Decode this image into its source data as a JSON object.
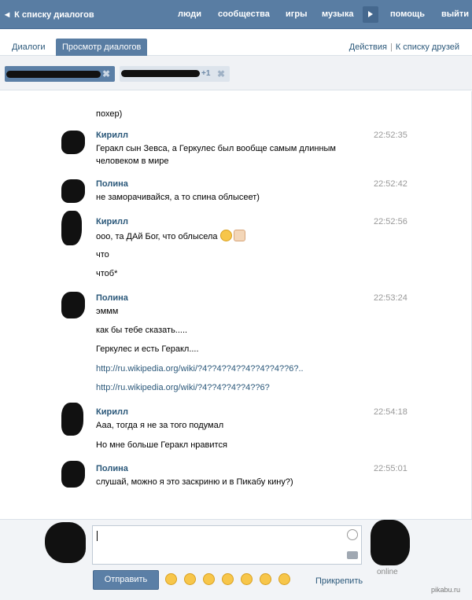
{
  "nav": {
    "back_label": "К списку диалогов",
    "links": [
      "люди",
      "сообщества",
      "игры",
      "музыка",
      "помощь",
      "выйти"
    ],
    "accent": "#597da3"
  },
  "tabs": {
    "items": [
      "Диалоги",
      "Просмотр диалогов"
    ],
    "active": "Просмотр диалогов",
    "actions_label": "Действия",
    "friends_label": "К списку друзей",
    "separator": "|"
  },
  "chips": {
    "plus_count": "+1",
    "close_glyph": "✖"
  },
  "messages": [
    {
      "author": "",
      "time": "",
      "lines": [
        "похер)"
      ]
    },
    {
      "author": "Кирилл",
      "time": "22:52:35",
      "lines": [
        "Геракл сын Зевса, а Геркулес был вообще самым длинным",
        "человеком в мире"
      ]
    },
    {
      "author": "Полина",
      "time": "22:52:42",
      "lines": [
        "не заморачивайся, а то спина облысеет)"
      ]
    },
    {
      "author": "Кирилл",
      "time": "22:52:56",
      "lines": [
        "ооо, та ДАй Бог, что облысела",
        "что",
        "чтоб*"
      ]
    },
    {
      "author": "Полина",
      "time": "22:53:24",
      "lines": [
        "эммм",
        "как бы тебе сказать.....",
        "Геркулес и есть Геракл....",
        "http://ru.wikipedia.org/wiki/?4??4??4??4??4??4??6?..",
        "http://ru.wikipedia.org/wiki/?4??4??4??4??6?"
      ]
    },
    {
      "author": "Кирилл",
      "time": "22:54:18",
      "lines": [
        "Ааа, тогда я не за того подумал",
        "Но мне больше Геракл нравится"
      ]
    },
    {
      "author": "Полина",
      "time": "22:55:01",
      "lines": [
        "слушай, можно я это заскриню и в Пикабу кину?)"
      ]
    }
  ],
  "composer": {
    "send_label": "Отправить",
    "attach_label": "Прикрепить",
    "online_label": "online"
  },
  "watermark": "pikabu.ru"
}
